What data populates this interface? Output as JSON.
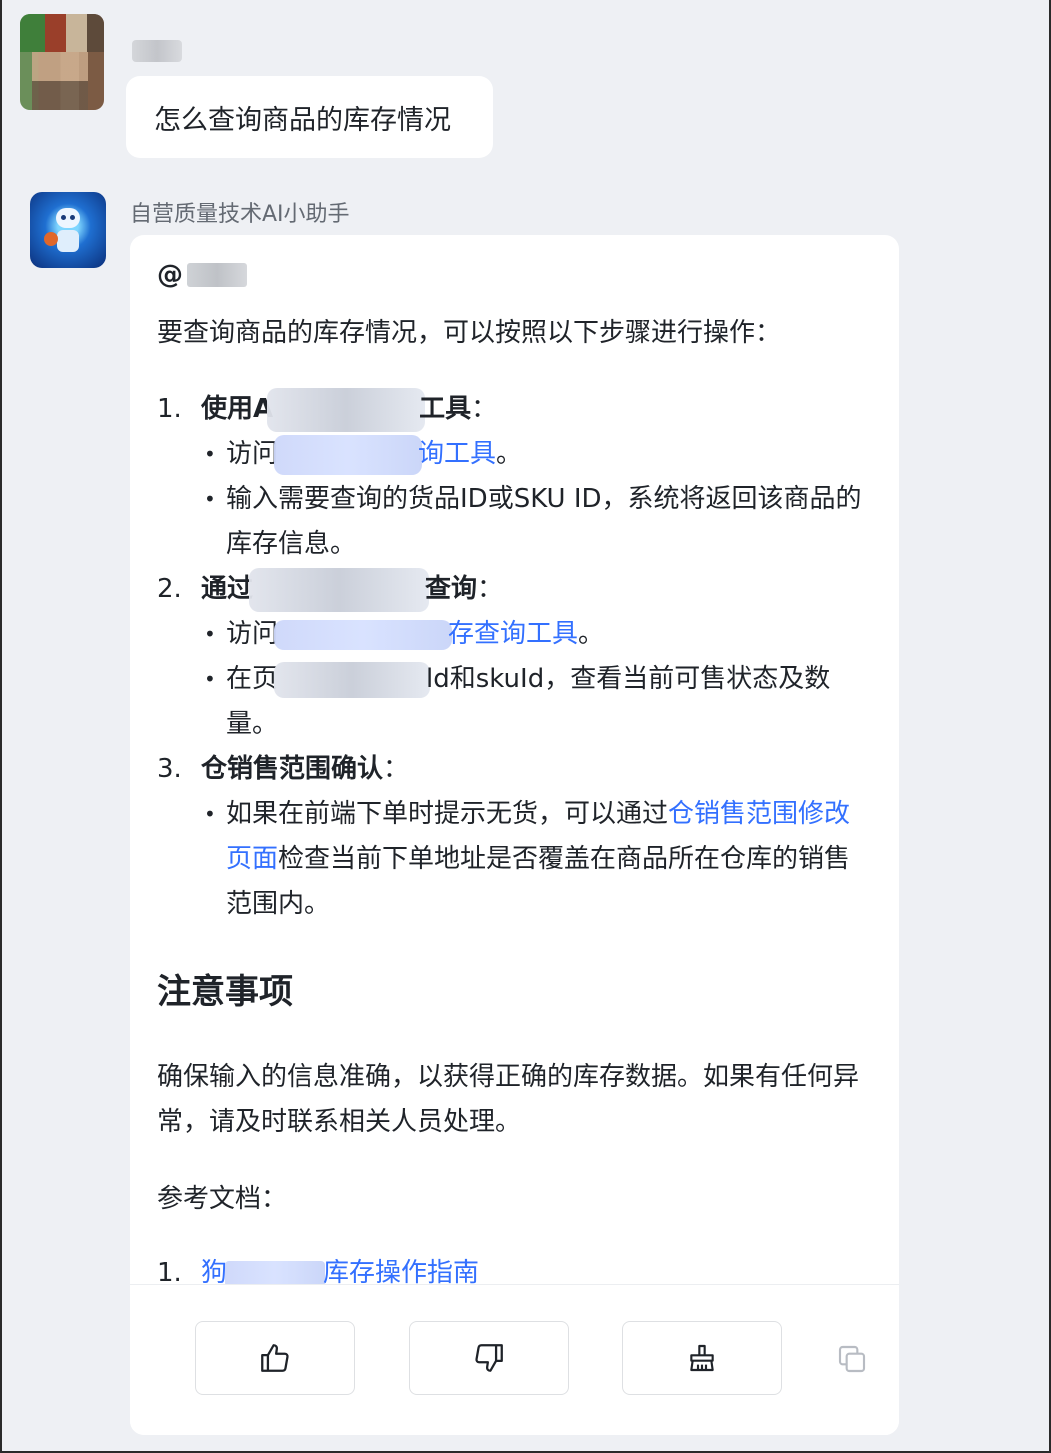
{
  "user": {
    "name": "",
    "message": "怎么查询商品的库存情况"
  },
  "bot": {
    "name": "自营质量技术AI小助手",
    "mention_prefix": "@",
    "intro": "要查询商品的库存情况，可以按照以下步骤进行操作：",
    "steps": [
      {
        "num": "1.",
        "title_visible_start": "使用A",
        "title_visible_end": "工具",
        "title_colon": "：",
        "subs": [
          {
            "prefix": "访问",
            "link_tail": "询工具",
            "suffix": "。"
          },
          {
            "text": "输入需要查询的货品ID或SKU ID，系统将返回该商品的库存信息。"
          }
        ]
      },
      {
        "num": "2.",
        "title_visible_start": "通过",
        "title_visible_end": "查询",
        "title_colon": "：",
        "subs": [
          {
            "prefix": "访问",
            "link_tail": "存查询工具",
            "suffix": "。"
          },
          {
            "prefix": "在页",
            "text_tail": "ld和skuId，查看当前可售状态及数量。"
          }
        ]
      },
      {
        "num": "3.",
        "title": "仓销售范围确认",
        "title_colon": "：",
        "subs": [
          {
            "prefix": "如果在前端下单时提示无货，可以通过",
            "link": "仓销售范围修改页面",
            "suffix": "检查当前下单地址是否覆盖在商品所在仓库的销售范围内。"
          }
        ]
      }
    ],
    "notice_heading": "注意事项",
    "notice_text": "确保输入的信息准确，以获得正确的库存数据。如果有任何异常，请及时联系相关人员处理。",
    "ref_title": "参考文档：",
    "refs": [
      {
        "num": "1.",
        "prefix": "狗",
        "link_tail": "库存操作指南"
      }
    ]
  },
  "footer": {
    "buttons": [
      "thumbs-up-icon",
      "thumbs-down-icon",
      "clear-icon"
    ],
    "copy_icon": "copy-icon"
  }
}
